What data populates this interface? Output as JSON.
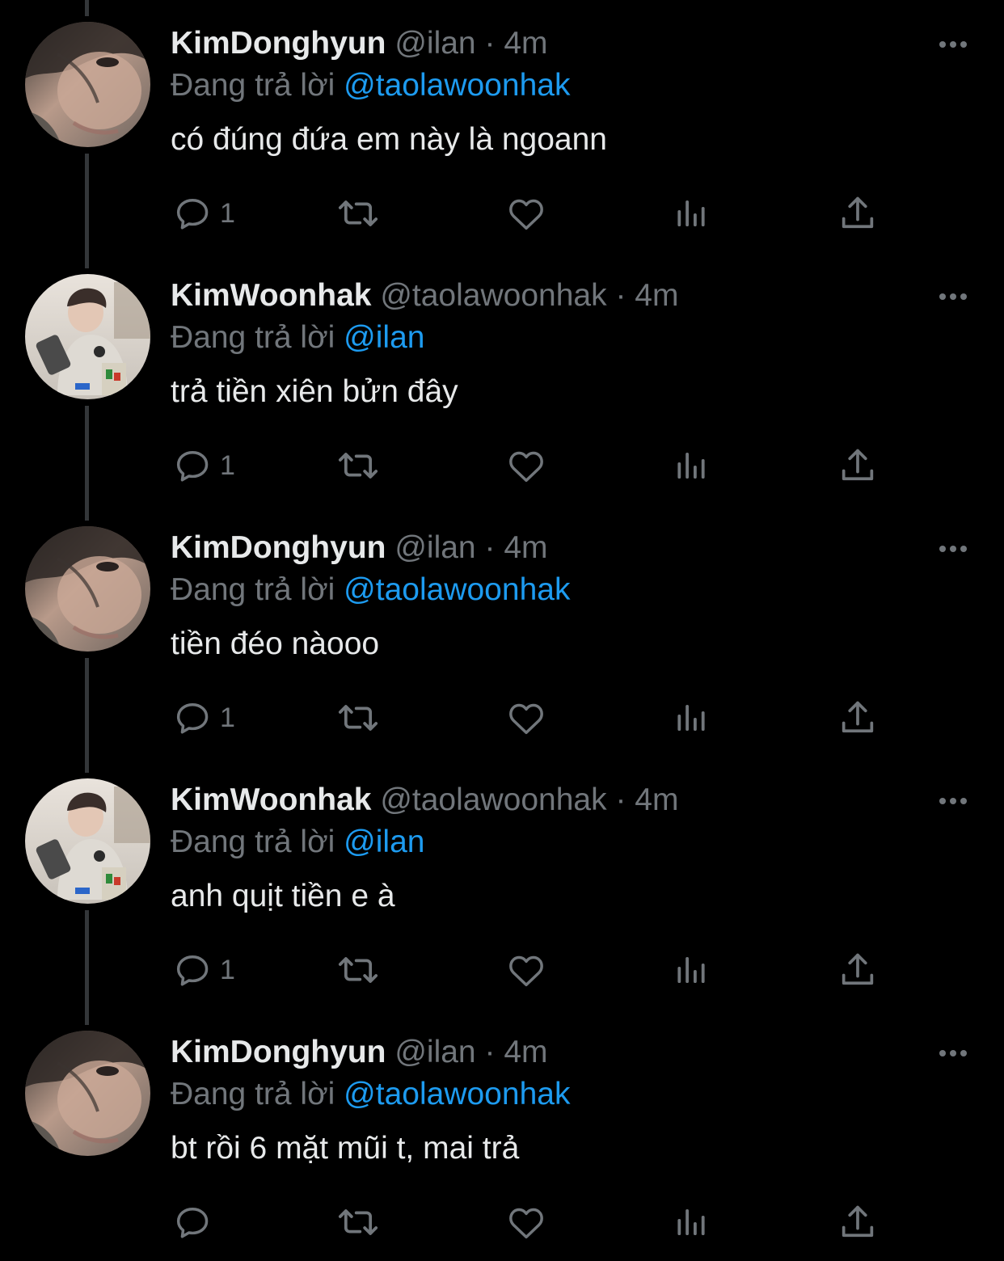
{
  "colors": {
    "background": "#000000",
    "text_primary": "#e7e9ea",
    "text_secondary": "#71767b",
    "mention": "#1d9bf0"
  },
  "icons": {
    "reply": "speech-bubble-icon",
    "retweet": "retweet-arrows-icon",
    "like": "heart-icon",
    "views": "bar-chart-icon",
    "share": "share-upload-icon",
    "more": "ellipsis-icon"
  },
  "tweets": [
    {
      "name": "KimDonghyun",
      "handle": "@ilan",
      "dot": "·",
      "time": "4m",
      "reply_prefix": "Đang trả lời",
      "reply_to": "@taolawoonhak",
      "text": "có đúng đứa em này là ngoann",
      "reply_count": "1"
    },
    {
      "name": "KimWoonhak",
      "handle": "@taolawoonhak",
      "dot": "·",
      "time": "4m",
      "reply_prefix": "Đang trả lời",
      "reply_to": "@ilan",
      "text": "trả tiền xiên bửn đây",
      "reply_count": "1"
    },
    {
      "name": "KimDonghyun",
      "handle": "@ilan",
      "dot": "·",
      "time": "4m",
      "reply_prefix": "Đang trả lời",
      "reply_to": "@taolawoonhak",
      "text": "tiền đéo nàooo",
      "reply_count": "1"
    },
    {
      "name": "KimWoonhak",
      "handle": "@taolawoonhak",
      "dot": "·",
      "time": "4m",
      "reply_prefix": "Đang trả lời",
      "reply_to": "@ilan",
      "text": "anh quịt tiền e à",
      "reply_count": "1"
    },
    {
      "name": "KimDonghyun",
      "handle": "@ilan",
      "dot": "·",
      "time": "4m",
      "reply_prefix": "Đang trả lời",
      "reply_to": "@taolawoonhak",
      "text": "bt rồi 6 mặt mũi t, mai trả",
      "reply_count": ""
    }
  ]
}
